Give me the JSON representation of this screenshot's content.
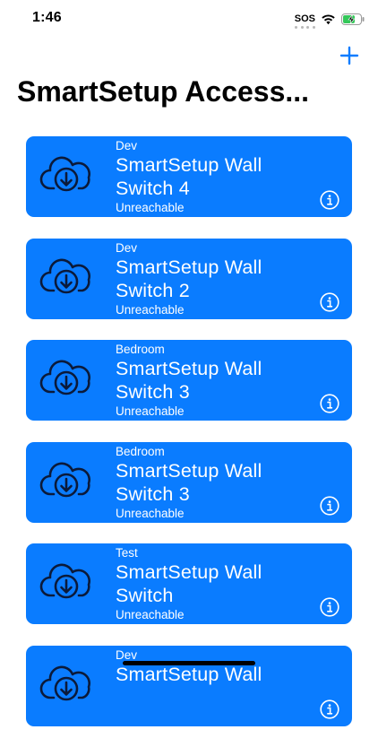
{
  "status_bar": {
    "time": "1:46",
    "carrier": "SOS"
  },
  "header": {
    "title": "SmartSetup Access..."
  },
  "icons": {
    "add": "plus-icon",
    "device": "cloud-download-icon",
    "info": "info-icon"
  },
  "colors": {
    "accent": "#0a7cff",
    "card_text": "#ffffff",
    "icon_stroke": "#0b1a3a"
  },
  "accessories": [
    {
      "room": "Dev",
      "name": "SmartSetup Wall Switch 4",
      "status": "Unreachable"
    },
    {
      "room": "Dev",
      "name": "SmartSetup Wall Switch 2",
      "status": "Unreachable"
    },
    {
      "room": "Bedroom",
      "name": "SmartSetup Wall Switch 3",
      "status": "Unreachable"
    },
    {
      "room": "Bedroom",
      "name": "SmartSetup Wall Switch 3",
      "status": "Unreachable"
    },
    {
      "room": "Test",
      "name": "SmartSetup Wall Switch",
      "status": "Unreachable"
    },
    {
      "room": "Dev",
      "name": "SmartSetup Wall",
      "status": ""
    }
  ]
}
